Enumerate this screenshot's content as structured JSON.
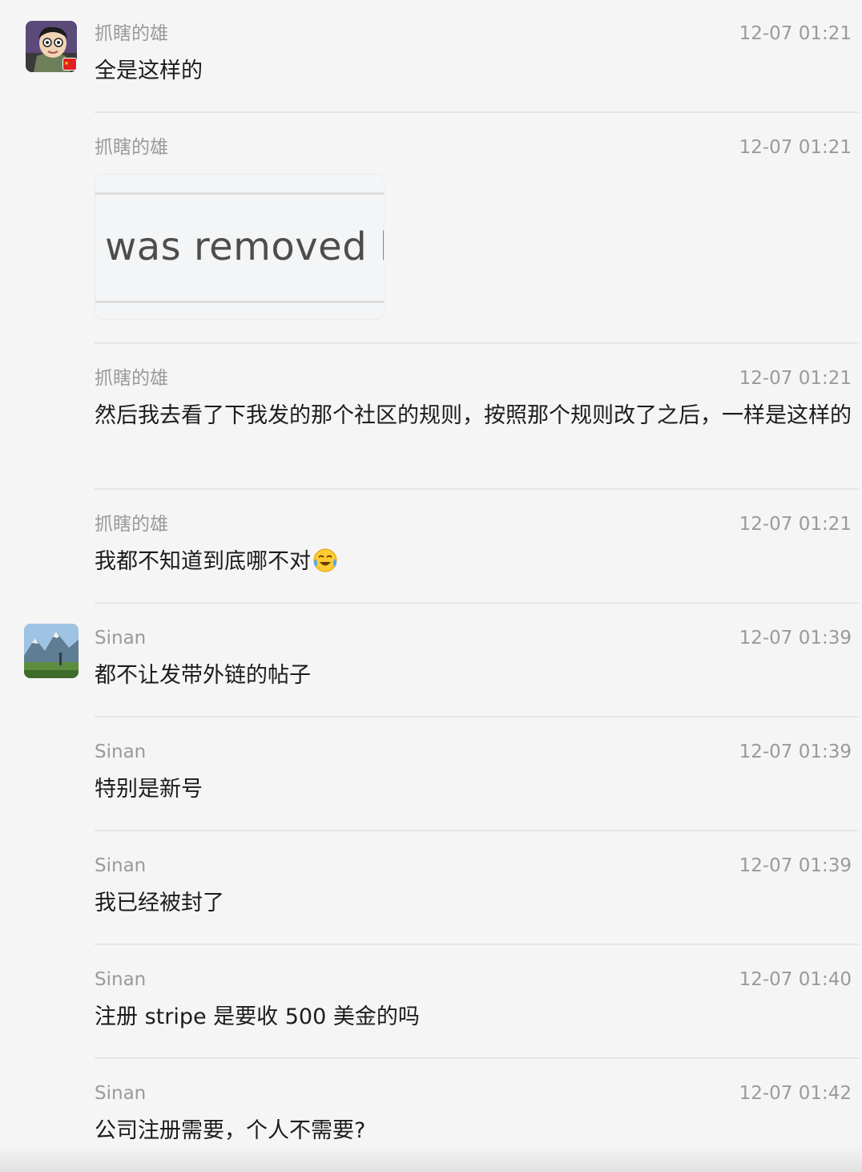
{
  "messages": [
    {
      "sender": "抓瞎的雄",
      "time": "12-07 01:21",
      "text": "全是这样的",
      "avatar": "cartoon-boy-avatar",
      "badge": "china-flag-icon"
    },
    {
      "sender": "抓瞎的雄",
      "time": "12-07 01:21",
      "image_text": "was removed by"
    },
    {
      "sender": "抓瞎的雄",
      "time": "12-07 01:21",
      "text": "然后我去看了下我发的那个社区的规则，按照那个规则改了之后，一样是这样的"
    },
    {
      "sender": "抓瞎的雄",
      "time": "12-07 01:21",
      "text": "我都不知道到底哪不对",
      "emoji": "crying-laughing-face-icon"
    },
    {
      "sender": "Sinan",
      "time": "12-07 01:39",
      "text": "都不让发带外链的帖子",
      "avatar": "mountain-landscape-avatar"
    },
    {
      "sender": "Sinan",
      "time": "12-07 01:39",
      "text": "特别是新号"
    },
    {
      "sender": "Sinan",
      "time": "12-07 01:39",
      "text": "我已经被封了"
    },
    {
      "sender": "Sinan",
      "time": "12-07 01:40",
      "text": "注册 stripe 是要收 500 美金的吗"
    },
    {
      "sender": "Sinan",
      "time": "12-07 01:42",
      "text": "公司注册需要，个人不需要?"
    }
  ],
  "colors": {
    "background": "#f5f5f5",
    "meta_text": "#9a9a9a",
    "body_text": "#1c1c1c",
    "separator": "#e6e6e6"
  }
}
